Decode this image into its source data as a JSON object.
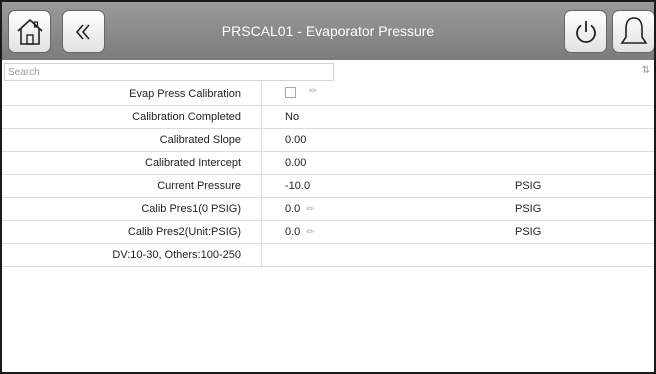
{
  "header": {
    "title": "PRSCAL01 - Evaporator Pressure",
    "home_icon": "home-icon",
    "back_icon": "back-double-chevron-icon",
    "power_icon": "power-icon",
    "alarm_icon": "bell-icon"
  },
  "search": {
    "placeholder": "Search",
    "value": ""
  },
  "rows": [
    {
      "label": "Evap Press Calibration",
      "value": "",
      "unit": "",
      "control": "checkbox",
      "checked": false,
      "editable": true
    },
    {
      "label": "Calibration Completed",
      "value": "No",
      "unit": "",
      "editable": false
    },
    {
      "label": "Calibrated Slope",
      "value": "0.00",
      "unit": "",
      "editable": false
    },
    {
      "label": "Calibrated Intercept",
      "value": "0.00",
      "unit": "",
      "editable": false
    },
    {
      "label": "Current Pressure",
      "value": "-10.0",
      "unit": "PSIG",
      "editable": false
    },
    {
      "label": "Calib Pres1(0 PSIG)",
      "value": "0.0",
      "unit": "PSIG",
      "editable": true
    },
    {
      "label": "Calib Pres2(Unit:PSIG)",
      "value": "0.0",
      "unit": "PSIG",
      "editable": true
    },
    {
      "label": "DV:10-30, Others:100-250",
      "value": "",
      "unit": "",
      "editable": false
    }
  ],
  "colors": {
    "header_top": "#9a9a9a",
    "header_bottom": "#7c7c7c",
    "title_text": "#ffffff"
  }
}
